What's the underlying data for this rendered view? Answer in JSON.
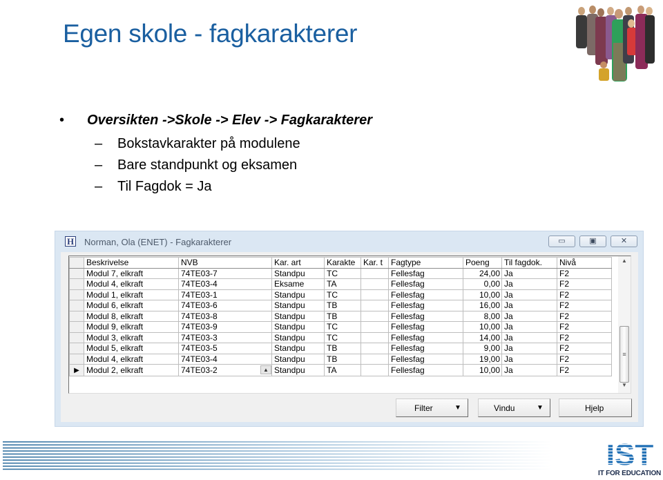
{
  "slide": {
    "title": "Egen skole - fagkarakterer",
    "bullet_marker": "•",
    "bullet_main": "Oversikten ->Skole -> Elev -> Fagkarakterer",
    "sub_marker": "–",
    "sub_items": [
      "Bokstavkarakter på modulene",
      "Bare standpunkt og eksamen",
      "Til Fagdok = Ja"
    ]
  },
  "window": {
    "icon_glyph": "H",
    "title": "Norman, Ola (ENET) - Fagkarakterer",
    "caption_buttons": {
      "minimize": "▭",
      "maximize": "▣",
      "close": "✕"
    },
    "grid": {
      "columns": [
        "Beskrivelse",
        "NVB",
        "Kar. art",
        "Karakte",
        "Kar. t",
        "Fagtype",
        "Poeng",
        "Til fagdok.",
        "Nivå"
      ],
      "rows": [
        [
          "Modul 7, elkraft",
          "74TE03-7",
          "Standpu",
          "TC",
          "",
          "Fellesfag",
          "24,00",
          "Ja",
          "F2"
        ],
        [
          "Modul 4, elkraft",
          "74TE03-4",
          "Eksame",
          "TA",
          "",
          "Fellesfag",
          "0,00",
          "Ja",
          "F2"
        ],
        [
          "Modul 1, elkraft",
          "74TE03-1",
          "Standpu",
          "TC",
          "",
          "Fellesfag",
          "10,00",
          "Ja",
          "F2"
        ],
        [
          "Modul 6, elkraft",
          "74TE03-6",
          "Standpu",
          "TB",
          "",
          "Fellesfag",
          "16,00",
          "Ja",
          "F2"
        ],
        [
          "Modul 8, elkraft",
          "74TE03-8",
          "Standpu",
          "TB",
          "",
          "Fellesfag",
          "8,00",
          "Ja",
          "F2"
        ],
        [
          "Modul 9, elkraft",
          "74TE03-9",
          "Standpu",
          "TC",
          "",
          "Fellesfag",
          "10,00",
          "Ja",
          "F2"
        ],
        [
          "Modul 3, elkraft",
          "74TE03-3",
          "Standpu",
          "TC",
          "",
          "Fellesfag",
          "14,00",
          "Ja",
          "F2"
        ],
        [
          "Modul 5, elkraft",
          "74TE03-5",
          "Standpu",
          "TB",
          "",
          "Fellesfag",
          "9,00",
          "Ja",
          "F2"
        ],
        [
          "Modul 4, elkraft",
          "74TE03-4",
          "Standpu",
          "TB",
          "",
          "Fellesfag",
          "19,00",
          "Ja",
          "F2"
        ],
        [
          "Modul 2, elkraft",
          "74TE03-2",
          "Standpu",
          "TA",
          "",
          "Fellesfag",
          "10,00",
          "Ja",
          "F2"
        ]
      ],
      "current_row_marker": "▶",
      "current_row_index": 9,
      "cell_spin_glyph": "▲"
    },
    "scrollbar": {
      "up": "▲",
      "down": "▼",
      "grip": "≡"
    },
    "buttons": [
      {
        "label": "Filter",
        "has_dropdown": true
      },
      {
        "label": "Vindu",
        "has_dropdown": true
      },
      {
        "label": "Hjelp",
        "has_dropdown": false
      }
    ],
    "dropdown_caret": "▼"
  },
  "branding": {
    "logo_text": "IST",
    "tagline": "IT FOR EDUCATION",
    "brand_color": "#1f6fb5"
  }
}
